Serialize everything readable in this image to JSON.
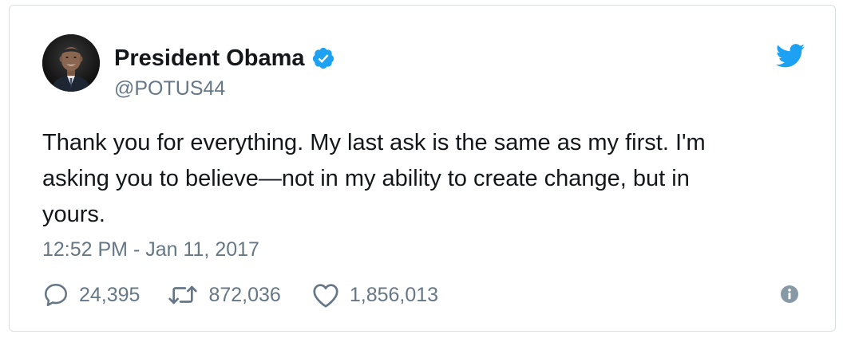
{
  "tweet": {
    "author": {
      "display_name": "President Obama",
      "handle": "@POTUS44",
      "verified": true,
      "avatar_icon": "profile-photo"
    },
    "text": "Thank you for everything. My last ask is the same as my first. I'm\nasking you to believe—not in my ability to create change, but in\nyours.",
    "timestamp": "12:52 PM - Jan 11, 2017",
    "stats": {
      "replies": "24,395",
      "retweets": "872,036",
      "likes": "1,856,013"
    },
    "icons": {
      "brand": "twitter-bird-icon",
      "verified": "verified-badge-icon",
      "reply": "reply-icon",
      "retweet": "retweet-icon",
      "like": "heart-icon",
      "info": "info-icon"
    },
    "colors": {
      "brand_blue": "#1da1f2",
      "secondary_text": "#657786",
      "primary_text": "#14171a",
      "border": "#d9dee2"
    }
  }
}
